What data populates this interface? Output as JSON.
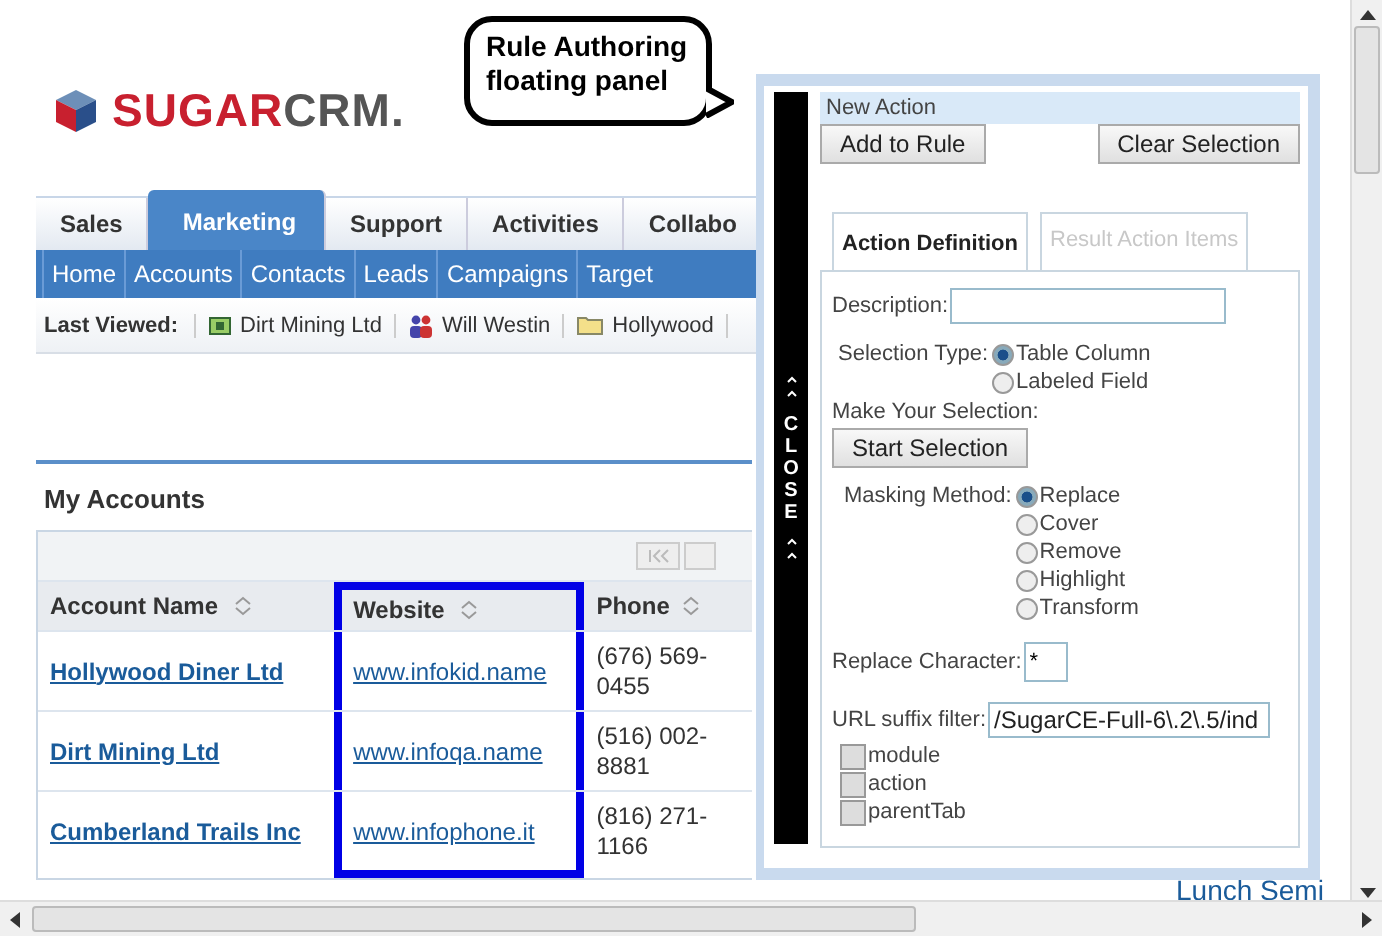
{
  "logo": {
    "brand_a": "SUGAR",
    "brand_b": "CRM."
  },
  "callout": {
    "text": "Rule Authoring floating panel"
  },
  "tabs": [
    {
      "label": "Sales",
      "selected": false
    },
    {
      "label": "Marketing",
      "selected": true
    },
    {
      "label": "Support",
      "selected": false
    },
    {
      "label": "Activities",
      "selected": false
    },
    {
      "label": "Collabo",
      "selected": false
    }
  ],
  "nav": [
    "Home",
    "Accounts",
    "Contacts",
    "Leads",
    "Campaigns",
    "Target"
  ],
  "last_viewed": {
    "label": "Last Viewed:",
    "items": [
      {
        "kind": "account",
        "text": "Dirt Mining Ltd"
      },
      {
        "kind": "contact",
        "text": "Will Westin"
      },
      {
        "kind": "folder",
        "text": "Hollywood"
      }
    ]
  },
  "dashlet": {
    "title": "My Accounts",
    "columns": [
      {
        "label": "Account Name",
        "highlighted": false
      },
      {
        "label": "Website",
        "highlighted": true
      },
      {
        "label": "Phone",
        "highlighted": false
      }
    ],
    "rows": [
      {
        "name": "Hollywood Diner Ltd",
        "website": "www.infokid.name",
        "phone": "(676) 569-0455"
      },
      {
        "name": "Dirt Mining Ltd",
        "website": "www.infoqa.name",
        "phone": "(516) 002-8881"
      },
      {
        "name": "Cumberland Trails Inc",
        "website": "www.infophone.it",
        "phone": "(816) 271-1166"
      }
    ]
  },
  "background_link": "Lunch Semi",
  "panel": {
    "header": "New Action",
    "buttons": [
      "Add to Rule",
      "Clear Selection"
    ],
    "close_label": "CLOSE",
    "tabs": [
      {
        "label": "Action Definition",
        "selected": true
      },
      {
        "label": "Result Action Items",
        "selected": false
      }
    ],
    "description_label": "Description:",
    "selection_type": {
      "label": "Selection Type:",
      "options": [
        {
          "label": "Table Column",
          "selected": true
        },
        {
          "label": "Labeled Field",
          "selected": false
        }
      ]
    },
    "make_selection": {
      "label": "Make Your Selection:",
      "button": "Start Selection"
    },
    "masking": {
      "label": "Masking Method:",
      "options": [
        {
          "label": "Replace",
          "selected": true
        },
        {
          "label": "Cover",
          "selected": false
        },
        {
          "label": "Remove",
          "selected": false
        },
        {
          "label": "Highlight",
          "selected": false
        },
        {
          "label": "Transform",
          "selected": false
        }
      ]
    },
    "replace_character": {
      "label": "Replace Character:",
      "value": "*"
    },
    "url_filter": {
      "label": "URL suffix filter:",
      "value": "/SugarCE-Full-6\\.2\\.5/ind"
    },
    "params": [
      {
        "label": "module",
        "checked": false
      },
      {
        "label": "action",
        "checked": false
      },
      {
        "label": "parentTab",
        "checked": false
      }
    ]
  }
}
